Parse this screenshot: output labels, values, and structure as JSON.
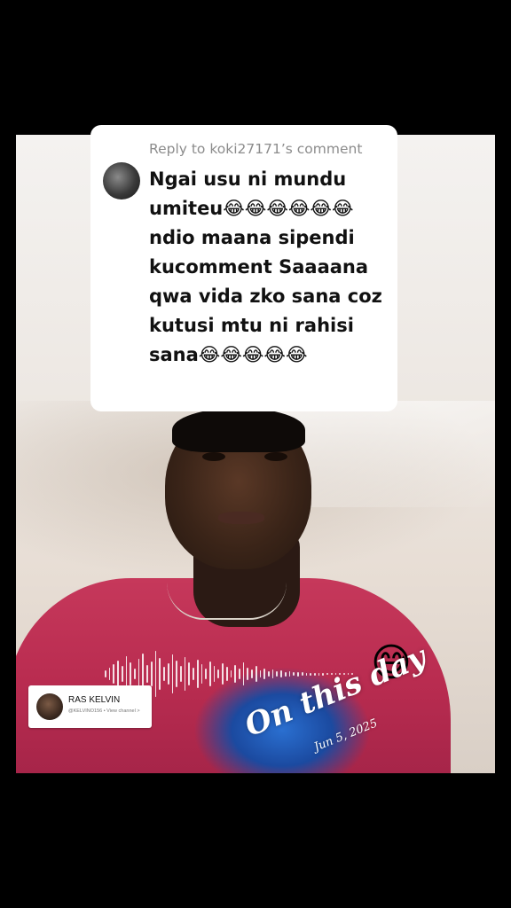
{
  "comment": {
    "reply_label": "Reply to koki27171’s comment",
    "text": "Ngai usu ni mundu umiteu😂😂😂😂😂😂 ndio maana sipendi kucomment Saaaana qwa vida zko sana coz kutusi mtu ni rahisi sana😂😂😂😂😂"
  },
  "sticker": {
    "name": "RAS KELVIN",
    "meta": "@KELVINO156 • View channel >"
  },
  "overlay": {
    "title": "On this day",
    "date": "Jun 5, 2025",
    "emoji": "😅"
  }
}
